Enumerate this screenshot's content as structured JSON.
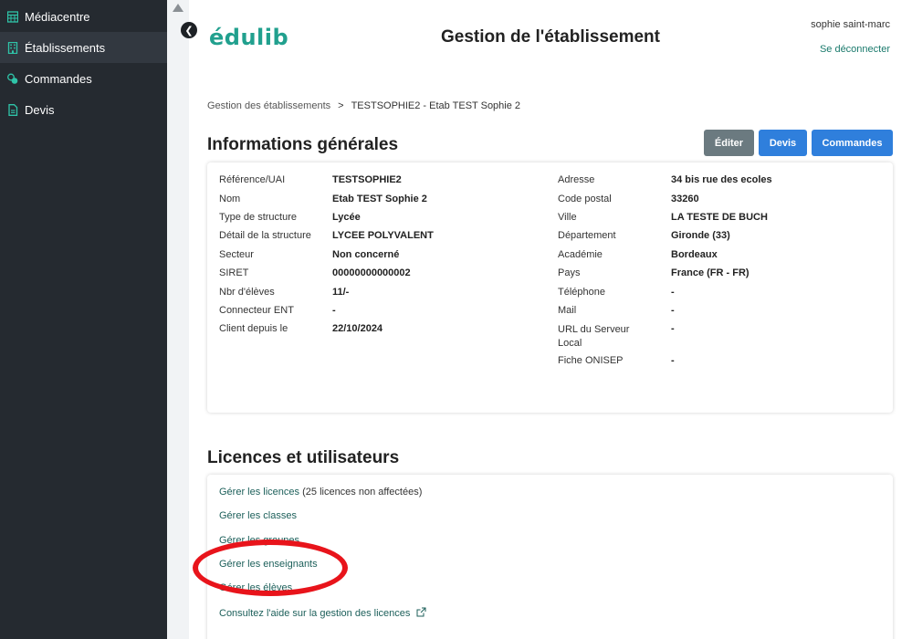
{
  "sidebar": {
    "items": [
      {
        "label": "Médiacentre",
        "icon": "table-icon",
        "active": false
      },
      {
        "label": "Établissements",
        "icon": "building-icon",
        "active": true
      },
      {
        "label": "Commandes",
        "icon": "coins-icon",
        "active": false
      },
      {
        "label": "Devis",
        "icon": "file-icon",
        "active": false
      }
    ]
  },
  "header": {
    "logo": "édulib",
    "title": "Gestion de l'établissement",
    "user": "sophie saint-marc",
    "logout": "Se déconnecter"
  },
  "breadcrumb": {
    "parent": "Gestion des établissements",
    "separator": ">",
    "current": "TESTSOPHIE2 - Etab TEST Sophie 2"
  },
  "info": {
    "title": "Informations générales",
    "buttons": {
      "edit": "Éditer",
      "devis": "Devis",
      "commandes": "Commandes"
    },
    "left": [
      {
        "label": "Référence/UAI",
        "value": "TESTSOPHIE2"
      },
      {
        "label": "Nom",
        "value": "Etab TEST Sophie 2"
      },
      {
        "label": "Type de structure",
        "value": "Lycée"
      },
      {
        "label": "Détail de la structure",
        "value": "LYCEE POLYVALENT"
      },
      {
        "label": "Secteur",
        "value": "Non concerné"
      },
      {
        "label": "SIRET",
        "value": "00000000000002"
      },
      {
        "label": "Nbr d'élèves",
        "value": "11/-"
      },
      {
        "label": "Connecteur ENT",
        "value": "-"
      },
      {
        "label": "Client depuis le",
        "value": "22/10/2024"
      }
    ],
    "right": [
      {
        "label": "Adresse",
        "value": "34 bis rue des ecoles"
      },
      {
        "label": "Code postal",
        "value": "33260"
      },
      {
        "label": "Ville",
        "value": "LA TESTE DE BUCH"
      },
      {
        "label": "Département",
        "value": "Gironde (33)"
      },
      {
        "label": "Académie",
        "value": "Bordeaux"
      },
      {
        "label": "Pays",
        "value": "France (FR - FR)"
      },
      {
        "label": "Téléphone",
        "value": "-"
      },
      {
        "label": "Mail",
        "value": "-"
      },
      {
        "label": "URL du Serveur Local",
        "value": "-"
      },
      {
        "label": "Fiche ONISEP",
        "value": "-"
      }
    ]
  },
  "licences": {
    "title": "Licences et utilisateurs",
    "manage_licences": "Gérer les licences",
    "licences_note": "(25 licences non affectées)",
    "manage_classes": "Gérer les classes",
    "manage_groups": "Gérer les groupes",
    "manage_teachers": "Gérer les enseignants",
    "manage_students": "Gérer les élèves",
    "help": "Consultez l'aide sur la gestion des licences"
  },
  "colors": {
    "sidebar_bg": "#252a30",
    "brand": "#21a08e",
    "primary": "#2f7fdc",
    "secondary": "#6b7a80",
    "annotation": "#e8141b"
  }
}
